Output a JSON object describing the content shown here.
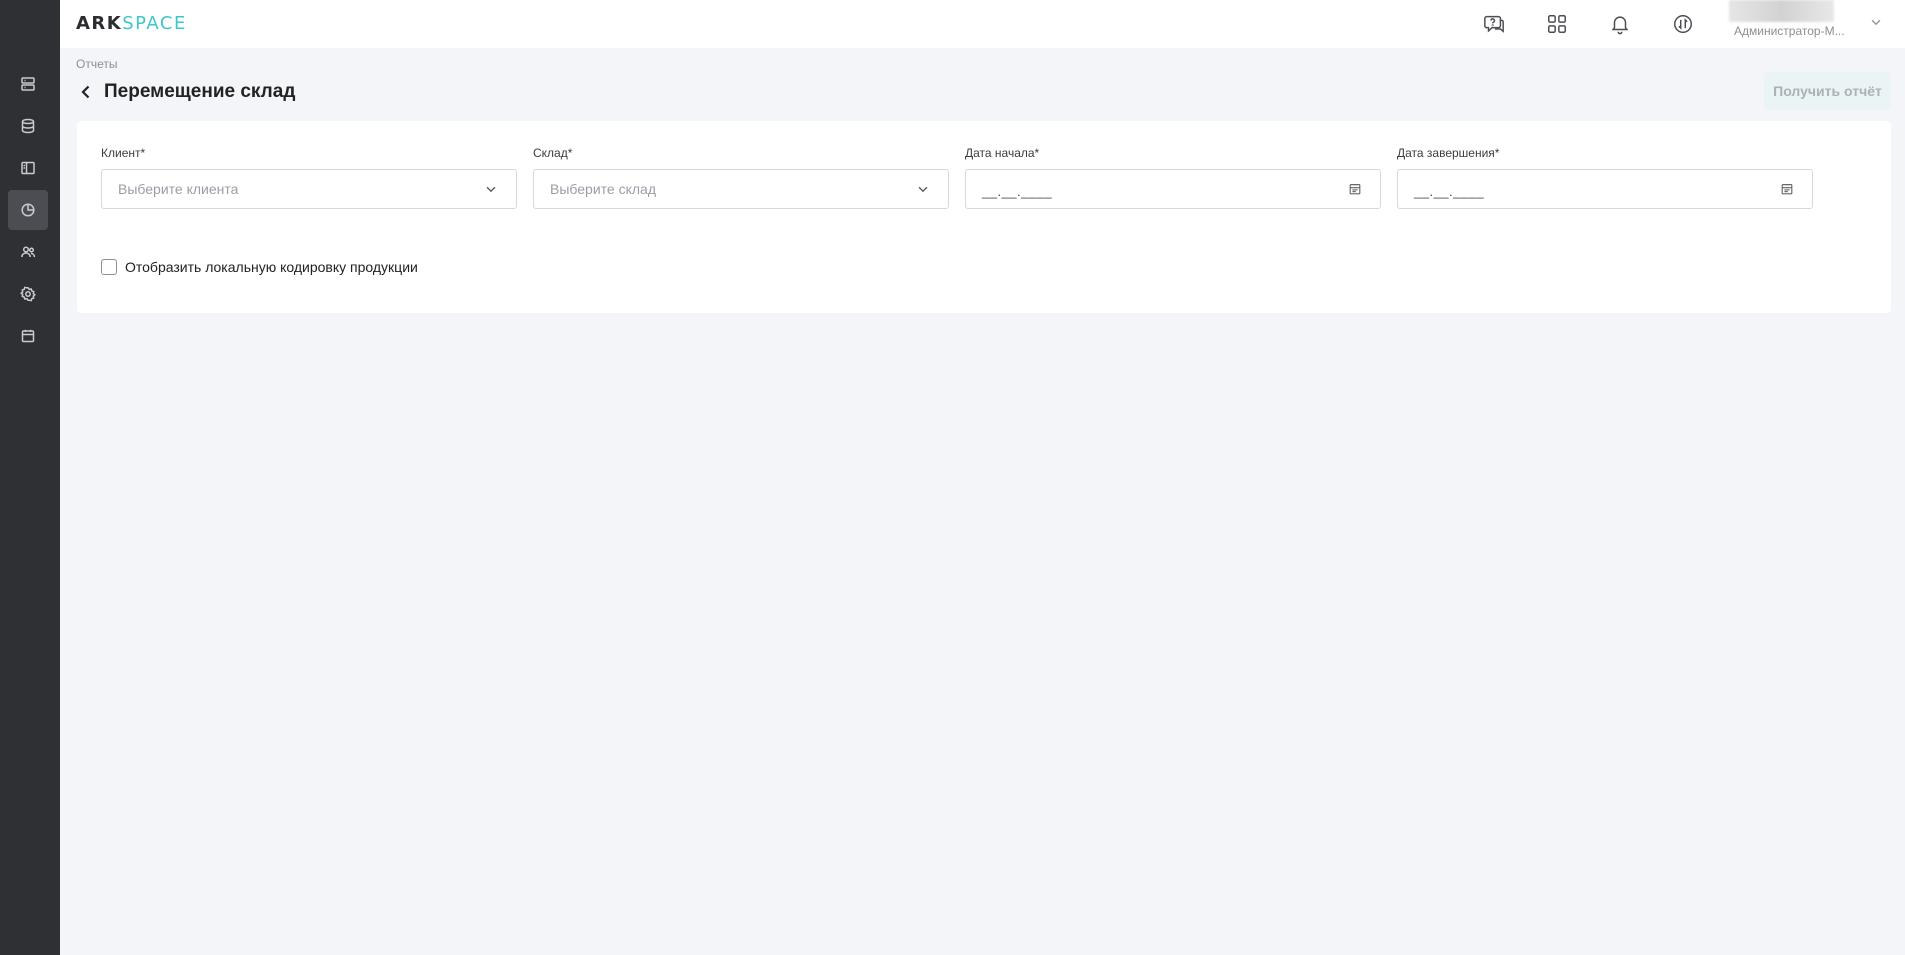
{
  "header": {
    "logo_ark": "ARK",
    "logo_space": "SPACE",
    "user_name": "Администратор-М..."
  },
  "page": {
    "breadcrumb": "Отчеты",
    "title": "Перемещение склад",
    "get_report_label": "Получить отчёт"
  },
  "form": {
    "client_label": "Клиент*",
    "client_placeholder": "Выберите клиента",
    "warehouse_label": "Склад*",
    "warehouse_placeholder": "Выберите склад",
    "start_date_label": "Дата начала*",
    "start_date_value": "__.__.____",
    "end_date_label": "Дата завершения*",
    "end_date_value": "__.__.____",
    "local_encoding_label": "Отобразить локальную кодировку продукции"
  },
  "sidebar": {
    "items": [
      {
        "icon": "server-icon",
        "active": false
      },
      {
        "icon": "database-icon",
        "active": false
      },
      {
        "icon": "layout-icon",
        "active": false
      },
      {
        "icon": "reports-pie-icon",
        "active": true
      },
      {
        "icon": "users-icon",
        "active": false
      },
      {
        "icon": "settings-gear-icon",
        "active": false
      },
      {
        "icon": "calendar-icon",
        "active": false
      }
    ]
  },
  "colors": {
    "sidebar_bg": "#2f3033",
    "sidebar_active": "#4b4d52",
    "brand_accent": "#3fc6cc",
    "page_bg": "#f4f5f9",
    "button_disabled_bg": "#eaf4f4"
  }
}
